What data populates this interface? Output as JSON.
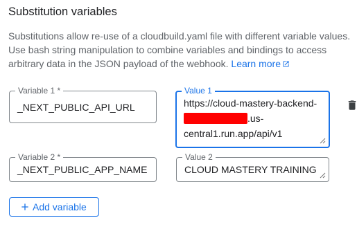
{
  "section": {
    "title": "Substitution variables",
    "description": "Substitutions allow re-use of a cloudbuild.yaml file with different variable values. Use bash string manipulation to combine variables and bindings to access arbitrary data in the JSON payload of the webhook.",
    "learn_more": "Learn more"
  },
  "variables": [
    {
      "name_label": "Variable 1 *",
      "name_value": "_NEXT_PUBLIC_API_URL",
      "value_label": "Value 1",
      "value_lines": [
        "https://cloud-mastery-backend-",
        ".us-",
        "central1.run.app/api/v1"
      ]
    },
    {
      "name_label": "Variable 2 *",
      "name_value": "_NEXT_PUBLIC_APP_NAME",
      "value_label": "Value 2",
      "value_text": "CLOUD MASTERY TRAINING"
    }
  ],
  "add_button": {
    "label": "Add variable"
  },
  "colors": {
    "accent": "#1a73e8",
    "border": "#80868b",
    "redaction": "#ff0000"
  },
  "icons": {
    "delete": "trash-icon",
    "add": "plus-icon",
    "external_link": "open-in-new-icon"
  }
}
